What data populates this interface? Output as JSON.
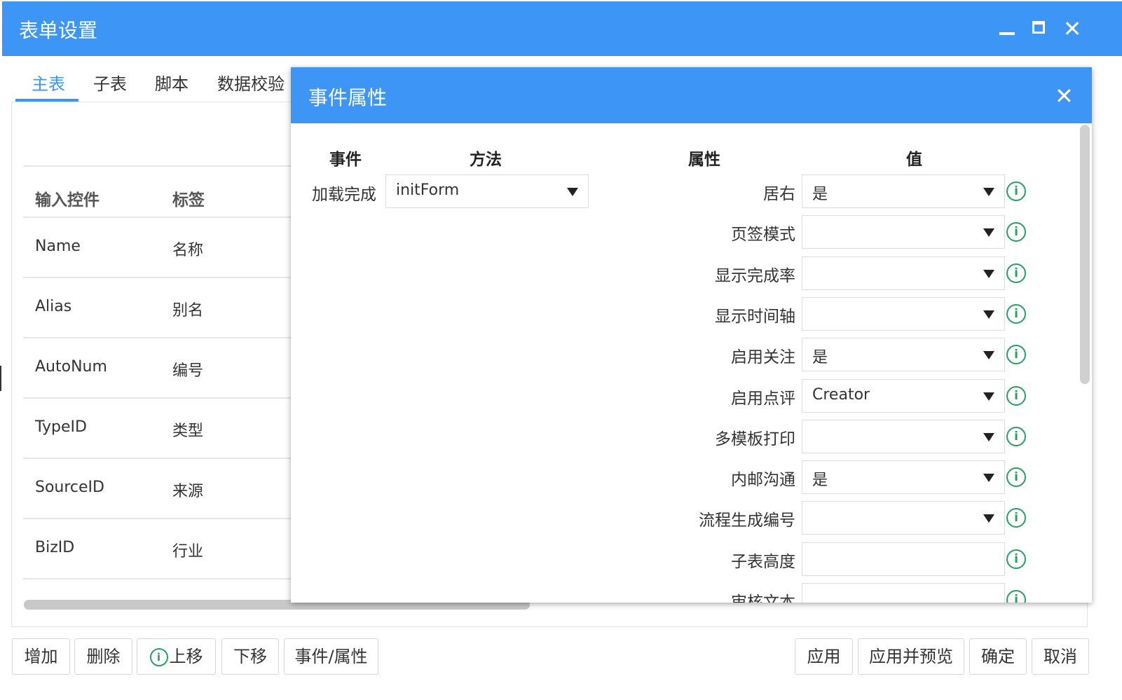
{
  "window": {
    "title": "表单设置",
    "minimize_icon": "minimize-icon",
    "maximize_icon": "maximize-icon",
    "close_glyph": "✕"
  },
  "tabs": [
    {
      "label": "主表",
      "active": true
    },
    {
      "label": "子表"
    },
    {
      "label": "脚本"
    },
    {
      "label": "数据校验"
    }
  ],
  "table": {
    "headers": [
      "输入控件",
      "标签"
    ],
    "rows": [
      {
        "control": "Name",
        "label": "名称"
      },
      {
        "control": "Alias",
        "label": "别名"
      },
      {
        "control": "AutoNum",
        "label": "编号"
      },
      {
        "control": "TypeID",
        "label": "类型"
      },
      {
        "control": "SourceID",
        "label": "来源"
      },
      {
        "control": "BizID",
        "label": "行业"
      }
    ]
  },
  "bottom_left_buttons": [
    "增加",
    "删除",
    "上移",
    "下移",
    "事件/属性"
  ],
  "bottom_right_buttons": [
    "应用",
    "应用并预览",
    "确定",
    "取消"
  ],
  "dialog": {
    "title": "事件属性",
    "close_glyph": "✕",
    "event_headers": [
      "事件",
      "方法"
    ],
    "events": [
      {
        "event": "加载完成",
        "method": "initForm"
      }
    ],
    "prop_headers": [
      "属性",
      "值"
    ],
    "properties": [
      {
        "name": "居右",
        "value": "是",
        "type": "select"
      },
      {
        "name": "页签模式",
        "value": "",
        "type": "select"
      },
      {
        "name": "显示完成率",
        "value": "",
        "type": "select"
      },
      {
        "name": "显示时间轴",
        "value": "",
        "type": "select"
      },
      {
        "name": "启用关注",
        "value": "是",
        "type": "select"
      },
      {
        "name": "启用点评",
        "value": "Creator",
        "type": "select"
      },
      {
        "name": "多模板打印",
        "value": "",
        "type": "select"
      },
      {
        "name": "内邮沟通",
        "value": "是",
        "type": "select"
      },
      {
        "name": "流程生成编号",
        "value": "",
        "type": "select"
      },
      {
        "name": "子表高度",
        "value": "",
        "type": "text"
      },
      {
        "name": "审核文本",
        "value": "",
        "type": "text"
      }
    ],
    "info_glyph": "i"
  },
  "colors": {
    "accent": "#3d96f6",
    "info": "#28a060"
  }
}
